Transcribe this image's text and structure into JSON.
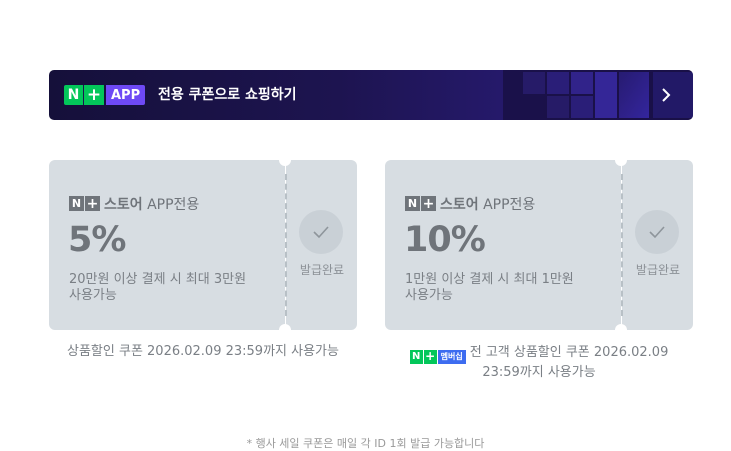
{
  "banner": {
    "logo_n": "N",
    "logo_plus": "+",
    "logo_app": "APP",
    "text": "전용 쿠폰으로 쇼핑하기",
    "arrow_icon": "chevron-right-icon"
  },
  "coupons": [
    {
      "brand_n": "N",
      "brand_plus": "+",
      "brand_store": "스토어",
      "brand_app": " APP전용",
      "discount": "5%",
      "condition_1": "20만원 이상 결제 시 최대 3만원",
      "condition_2": "사용가능",
      "status": "발급완료",
      "note": "상품할인 쿠폰 2026.02.09 23:59까지 사용가능"
    },
    {
      "brand_n": "N",
      "brand_plus": "+",
      "brand_store": "스토어",
      "brand_app": " APP전용",
      "discount": "10%",
      "condition_1": "1만원 이상 결제 시 최대 1만원",
      "condition_2": "사용가능",
      "status": "발급완료",
      "note_badge_n": "N",
      "note_badge_plus": "+",
      "note_badge_member": "멤버십",
      "note_line1": "전 고객 상품할인 쿠폰 2026.02.09",
      "note_line2": "23:59까지 사용가능"
    }
  ],
  "footer_text": "* 행사 세일 쿠폰은 매일 각 ID 1회 발급 가능합니다"
}
